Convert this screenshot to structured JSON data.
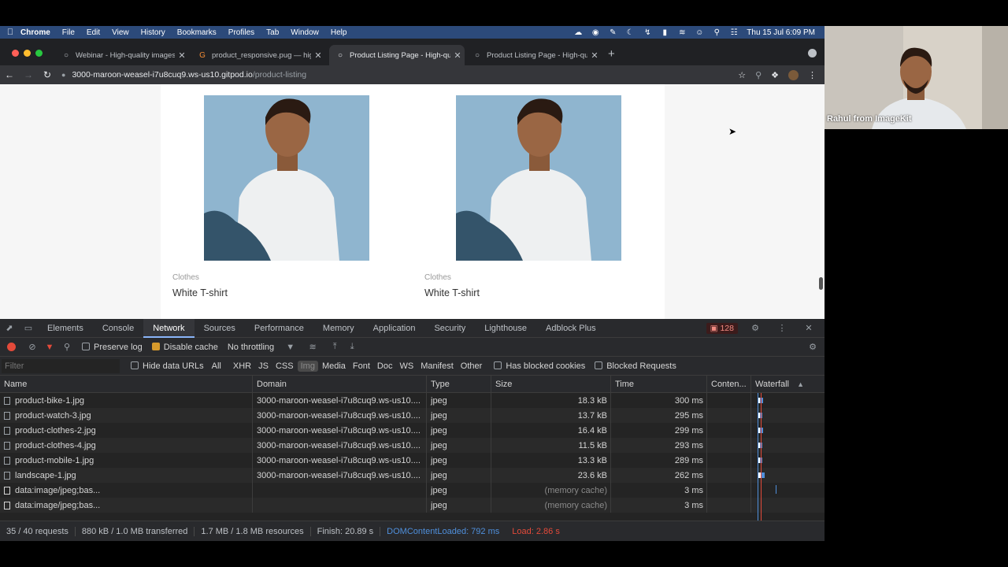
{
  "menubar": {
    "apple": "",
    "items": [
      "Chrome",
      "File",
      "Edit",
      "View",
      "History",
      "Bookmarks",
      "Profiles",
      "Tab",
      "Window",
      "Help"
    ],
    "clock": "Thu 15 Jul  6:09 PM"
  },
  "tabs": [
    {
      "title": "Webinar - High-quality images",
      "favicon": "globe-icon"
    },
    {
      "title": "product_responsive.pug — high",
      "favicon": "github-icon"
    },
    {
      "title": "Product Listing Page - High-qu",
      "favicon": "globe-icon",
      "active": true
    },
    {
      "title": "Product Listing Page - High-qu",
      "favicon": "globe-icon"
    }
  ],
  "address": {
    "host": "3000-maroon-weasel-i7u8cuq9.ws-us10.gitpod.io",
    "path": "/product-listing"
  },
  "products": [
    {
      "category": "Clothes",
      "name": "White T-shirt"
    },
    {
      "category": "Clothes",
      "name": "White T-shirt"
    }
  ],
  "devtools": {
    "tabs": [
      "Elements",
      "Console",
      "Network",
      "Sources",
      "Performance",
      "Memory",
      "Application",
      "Security",
      "Lighthouse",
      "Adblock Plus"
    ],
    "active_tab": "Network",
    "issues_count": "128",
    "toolbar": {
      "preserve_log": "Preserve log",
      "disable_cache": "Disable cache",
      "throttling": "No throttling"
    },
    "filter": {
      "placeholder": "Filter",
      "hide_data_urls": "Hide data URLs",
      "types": [
        "All",
        "XHR",
        "JS",
        "CSS",
        "Img",
        "Media",
        "Font",
        "Doc",
        "WS",
        "Manifest",
        "Other"
      ],
      "selected_type": "Img",
      "has_blocked_cookies": "Has blocked cookies",
      "blocked_requests": "Blocked Requests"
    },
    "columns": {
      "name": "Name",
      "domain": "Domain",
      "type": "Type",
      "size": "Size",
      "time": "Time",
      "content": "Conten...",
      "waterfall": "Waterfall"
    },
    "rows": [
      {
        "name": "product-bike-1.jpg",
        "domain": "3000-maroon-weasel-i7u8cuq9.ws-us10....",
        "type": "jpeg",
        "size": "18.3 kB",
        "time": "300 ms"
      },
      {
        "name": "product-watch-3.jpg",
        "domain": "3000-maroon-weasel-i7u8cuq9.ws-us10....",
        "type": "jpeg",
        "size": "13.7 kB",
        "time": "295 ms"
      },
      {
        "name": "product-clothes-2.jpg",
        "domain": "3000-maroon-weasel-i7u8cuq9.ws-us10....",
        "type": "jpeg",
        "size": "16.4 kB",
        "time": "299 ms"
      },
      {
        "name": "product-clothes-4.jpg",
        "domain": "3000-maroon-weasel-i7u8cuq9.ws-us10....",
        "type": "jpeg",
        "size": "11.5 kB",
        "time": "293 ms"
      },
      {
        "name": "product-mobile-1.jpg",
        "domain": "3000-maroon-weasel-i7u8cuq9.ws-us10....",
        "type": "jpeg",
        "size": "13.3 kB",
        "time": "289 ms"
      },
      {
        "name": "landscape-1.jpg",
        "domain": "3000-maroon-weasel-i7u8cuq9.ws-us10....",
        "type": "jpeg",
        "size": "23.6 kB",
        "time": "262 ms"
      },
      {
        "name": "data:image/jpeg;bas...",
        "domain": "",
        "type": "jpeg",
        "size": "(memory cache)",
        "time": "3 ms"
      },
      {
        "name": "data:image/jpeg;bas...",
        "domain": "",
        "type": "jpeg",
        "size": "(memory cache)",
        "time": "3 ms"
      }
    ],
    "status": {
      "requests": "35 / 40 requests",
      "transferred": "880 kB / 1.0 MB transferred",
      "resources": "1.7 MB / 1.8 MB resources",
      "finish": "Finish: 20.89 s",
      "dom_content_loaded": "DOMContentLoaded: 792 ms",
      "load": "Load: 2.86 s"
    }
  },
  "webcam": {
    "label": "Rahul from ImageKit"
  },
  "colors": {
    "menubar": "#2c4a7a",
    "devtools_bg": "#242424",
    "accent_blue": "#4f8fdb",
    "record_red": "#e34a3a"
  }
}
